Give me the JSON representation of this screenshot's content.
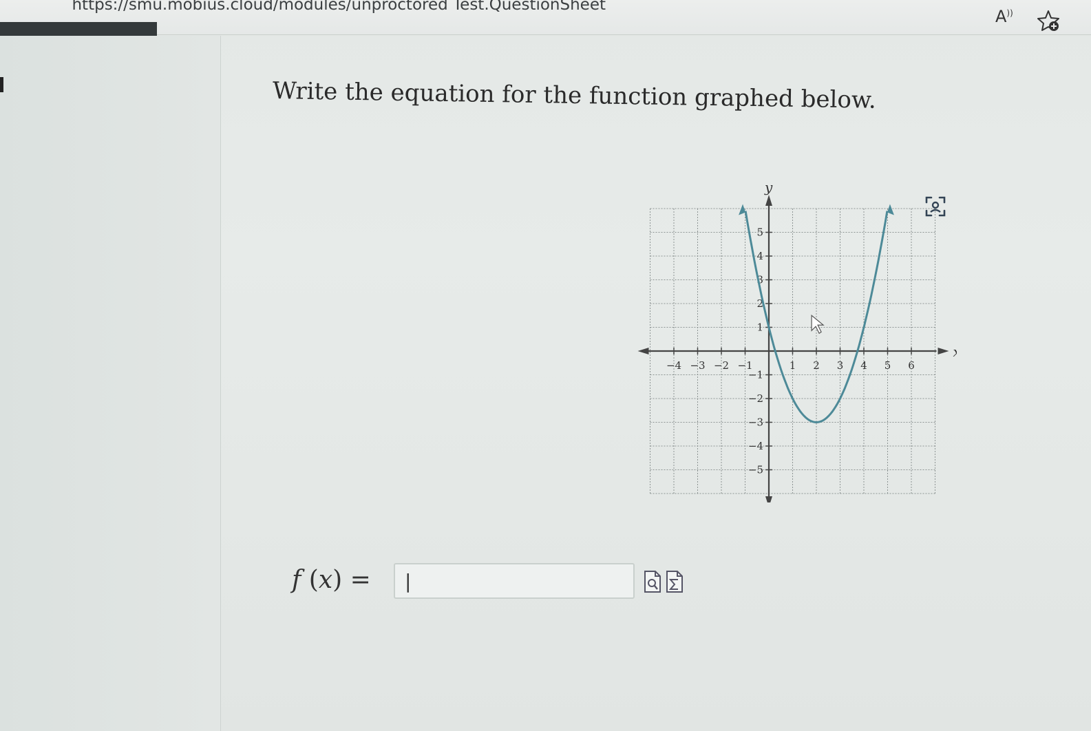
{
  "browser": {
    "url": "https://smu.mobius.cloud/modules/unproctored Test.QuestionSheet",
    "read_aloud_label": "A",
    "read_aloud_sup": "))"
  },
  "icons": {
    "read_aloud": "read-aloud-icon",
    "favorite": "add-favorite-star-icon",
    "screenshot": "screen-capture-icon",
    "preview": "preview-document-icon",
    "equation_editor": "equation-editor-sigma-icon"
  },
  "question": {
    "prompt": "Write the equation for the function graphed below."
  },
  "graph": {
    "x_label": "x",
    "y_label": "y",
    "x_ticks": [
      -4,
      -3,
      -2,
      -1,
      1,
      2,
      3,
      4,
      5,
      6
    ],
    "y_ticks": [
      5,
      4,
      3,
      2,
      1,
      -1,
      -2,
      -3,
      -4,
      -5
    ],
    "x_range": [
      -5,
      7
    ],
    "y_range": [
      -6,
      6
    ],
    "curve": {
      "type": "parabola",
      "vertex": [
        2,
        -3
      ],
      "points": [
        [
          0,
          1
        ],
        [
          1,
          -2
        ],
        [
          2,
          -3
        ],
        [
          3,
          -2
        ],
        [
          4,
          1
        ],
        [
          5,
          6
        ],
        [
          -1,
          6
        ]
      ],
      "color": "#4d8a98"
    }
  },
  "answer": {
    "label_f": "f",
    "label_x": "x",
    "value": "|"
  }
}
